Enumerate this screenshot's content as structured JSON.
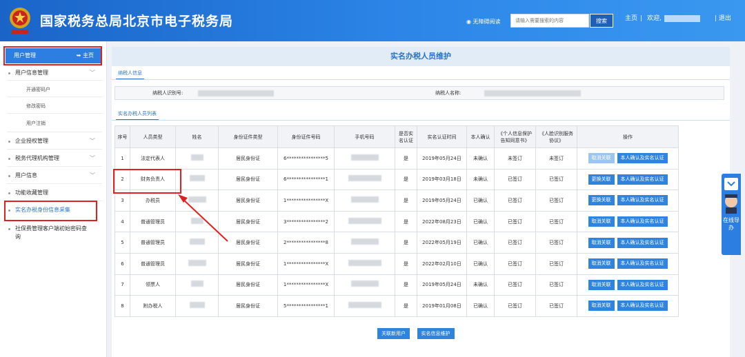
{
  "header": {
    "title": "国家税务总局北京市电子税务局",
    "accessibility_label": "无障碍阅读",
    "search_placeholder": "请输入需要搜索的内容",
    "search_button": "搜索",
    "nav_home": "主页",
    "nav_welcome": "欢迎,",
    "nav_logout": "退出"
  },
  "sidebar": {
    "top_label": "用户管理",
    "home_label": "主页",
    "items": [
      {
        "label": "用户信息管理"
      },
      {
        "label": "开通密码户"
      },
      {
        "label": "修改密码"
      },
      {
        "label": "用户注销"
      },
      {
        "label": "企业授权管理"
      },
      {
        "label": "税务代理机构管理"
      },
      {
        "label": "用户信息"
      },
      {
        "label": "功能收藏管理"
      },
      {
        "label": "实名办税身份信息采集"
      },
      {
        "label": "社保费管理客户端初始密码查询"
      }
    ]
  },
  "main": {
    "title": "实名办税人员维护",
    "tab_taxpayer": "纳税人信息",
    "label_taxid": "纳税人识别号:",
    "label_name": "纳税人名称:",
    "tab_list": "实名办税人员列表",
    "columns": [
      "序号",
      "人员类型",
      "姓名",
      "身份证件类型",
      "身份证件号码",
      "手机号码",
      "是否实名认证",
      "实名认证时间",
      "本人确认",
      "《个人信息保护告知同意书》",
      "《人脸识别服务协议》",
      "操作"
    ],
    "rows": [
      {
        "no": "1",
        "type": "法定代表人",
        "idtype": "居民身份证",
        "idno": "6****************5",
        "verified": "是",
        "date": "2019年05月24日",
        "confirm": "未确认",
        "consent": "未签订",
        "face": "未签订",
        "btn1": "取消关联",
        "btn2": "本人确认及实名认证",
        "btn1_disabled": true
      },
      {
        "no": "2",
        "type": "财务负责人",
        "idtype": "居民身份证",
        "idno": "6****************1",
        "verified": "是",
        "date": "2019年03月18日",
        "confirm": "未确认",
        "consent": "已签订",
        "face": "已签订",
        "btn1": "更换关联",
        "btn2": "本人确认及实名认证",
        "btn1_disabled": false
      },
      {
        "no": "3",
        "type": "办税员",
        "idtype": "居民身份证",
        "idno": "1****************X",
        "verified": "是",
        "date": "2019年05月24日",
        "confirm": "已确认",
        "consent": "已签订",
        "face": "已签订",
        "btn1": "更换关联",
        "btn2": "本人确认及实名认证",
        "btn1_disabled": false
      },
      {
        "no": "4",
        "type": "普通管理员",
        "idtype": "居民身份证",
        "idno": "3****************2",
        "verified": "是",
        "date": "2022年08月23日",
        "confirm": "已确认",
        "consent": "已签订",
        "face": "已签订",
        "btn1": "取消关联",
        "btn2": "本人确认及实名认证",
        "btn1_disabled": false
      },
      {
        "no": "5",
        "type": "普通管理员",
        "idtype": "居民身份证",
        "idno": "2****************8",
        "verified": "是",
        "date": "2022年05月19日",
        "confirm": "已确认",
        "consent": "已签订",
        "face": "已签订",
        "btn1": "取消关联",
        "btn2": "本人确认及实名认证",
        "btn1_disabled": false
      },
      {
        "no": "6",
        "type": "普通管理员",
        "idtype": "居民身份证",
        "idno": "1****************X",
        "verified": "是",
        "date": "2022年02月10日",
        "confirm": "已确认",
        "consent": "已签订",
        "face": "已签订",
        "btn1": "取消关联",
        "btn2": "本人确认及实名认证",
        "btn1_disabled": false
      },
      {
        "no": "7",
        "type": "领票人",
        "idtype": "居民身份证",
        "idno": "1****************X",
        "verified": "是",
        "date": "2019年05月24日",
        "confirm": "未确认",
        "consent": "已签订",
        "face": "已签订",
        "btn1": "取消关联",
        "btn2": "本人确认及实名认证",
        "btn1_disabled": false
      },
      {
        "no": "8",
        "type": "附办税人",
        "idtype": "居民身份证",
        "idno": "5****************1",
        "verified": "是",
        "date": "2019年01月08日",
        "confirm": "已确认",
        "consent": "已签订",
        "face": "已签订",
        "btn1": "取消关联",
        "btn2": "本人确认及实名认证",
        "btn1_disabled": false
      }
    ],
    "btn_add": "关联新用户",
    "btn_maintain": "实名信息维护"
  },
  "side_widget": {
    "label": "在线导办"
  },
  "colors": {
    "header_blue": "#1a64c8",
    "accent": "#2f84e0",
    "highlight_red": "#e02020",
    "link_blue": "#2a72c8"
  }
}
